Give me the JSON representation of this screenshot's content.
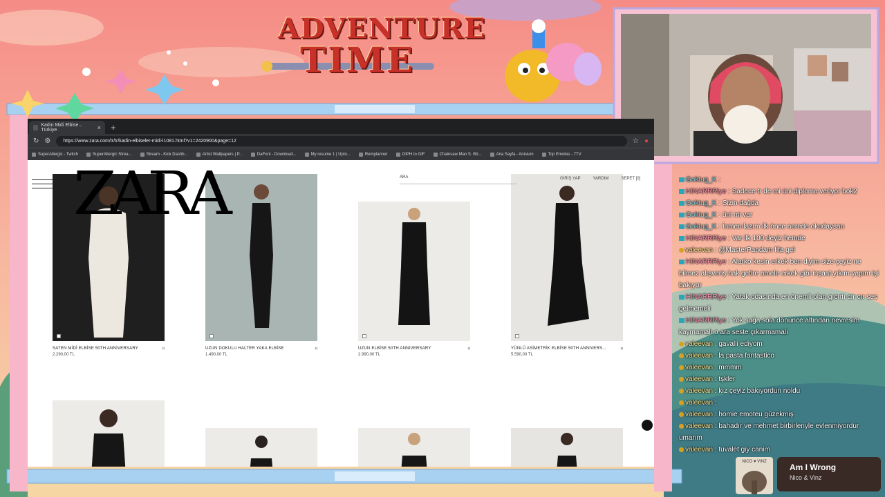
{
  "overlay": {
    "title_line1": "ADVENTURE",
    "title_line2": "TIME",
    "accent": "#c8302a",
    "frame_color": "#a8d0f0"
  },
  "browser": {
    "tab_title": "Kadın Midi Elbise... Türkiye",
    "new_tab": "+",
    "url": "https://www.zara.com/tr/tr/kadin-elbiseler-midi-l1081.html?v1=2420900&page=12",
    "bookmarks": [
      "SuperAllergic - Twitch",
      "SuperAllergic Strea...",
      "Stream - Kick Dashb...",
      "Artist Wallpapers | P...",
      "DaFont - Download...",
      "My resume 1 | Upto...",
      "Remplanner",
      "GIPH to GIF",
      "Chainsaw Man S. Bö...",
      "Ana Sayfa - Anisium",
      "Top Emotes - 7TV"
    ]
  },
  "zara": {
    "logo": "ZARA",
    "search_label": "ARA",
    "links": [
      "GİRİŞ YAP",
      "YARDIM",
      "SEPET [0]"
    ],
    "products": [
      {
        "name": "SATEN MİDİ ELBİSE 50TH ANNIVERSARY",
        "price": "2.290,00 TL",
        "color": "#ede8df"
      },
      {
        "name": "UZUN DOKULU HALTER YAKA ELBİSE",
        "price": "1.490,00 TL",
        "color": "#111111"
      },
      {
        "name": "UZUN ELBİSE 50TH ANNIVERSARY",
        "price": "2.990,00 TL",
        "color": "#111111"
      },
      {
        "name": "YÜNLÜ ASİMETRİK ELBİSE 50TH ANNIVERS...",
        "price": "5.590,00 TL",
        "color": "#111111"
      }
    ]
  },
  "chat": [
    {
      "user": "Goktug_K",
      "text": "",
      "color": "u1"
    },
    {
      "user": "HINARRRiye",
      "text": "Sadece tr de mi üni diploma veriyor bok2",
      "color": "u2"
    },
    {
      "user": "Goktug_K",
      "text": "Sizin dağda",
      "color": "u1"
    },
    {
      "user": "Goktug_K",
      "text": "üni mi var",
      "color": "u1"
    },
    {
      "user": "Goktug_K",
      "text": "İnmen lazım ilk önce nerede okudaysan",
      "color": "u1"
    },
    {
      "user": "HINARRRiye",
      "text": "Var ilk 100 deyiz hemde",
      "color": "u2"
    },
    {
      "user": "valeevan",
      "text": "@MasterPandam fifa gel",
      "color": "u3"
    },
    {
      "user": "HINARRRiye",
      "text": "Alarko kesin erkek ben diyim size çeyiz ne bilmez alışveriş hak getire amele erkek gibi inşaat yıkım yapım işi bakıyor",
      "color": "u2"
    },
    {
      "user": "HINARRRiye",
      "text": "Yatak odasında en önemli olan gıcırtı cır cır ses gelmemeli",
      "color": "u2"
    },
    {
      "user": "HINARRRiye",
      "text": "Yok sağa sola dönünce altından nevresim kaymamalı o ara seste çıkarmamalı",
      "color": "u2"
    },
    {
      "user": "valeevan",
      "text": "gavalli ediyom",
      "color": "u3"
    },
    {
      "user": "valeevan",
      "text": "la pasta fantastico",
      "color": "u3"
    },
    {
      "user": "valeevan",
      "text": "mmmm",
      "color": "u3"
    },
    {
      "user": "valeevan",
      "text": "tşkler",
      "color": "u3"
    },
    {
      "user": "valeevan",
      "text": "kız çeyiz bakıyordun noldu",
      "color": "u3"
    },
    {
      "user": "valeevan",
      "text": "",
      "color": "u3"
    },
    {
      "user": "valeevan",
      "text": "homie emoteu güzekmiş",
      "color": "u3"
    },
    {
      "user": "valeevan",
      "text": "bahadır ve mehmet birbirleriyle evlenmiyordur umarım",
      "color": "u3"
    },
    {
      "user": "valeevan",
      "text": "tuvalet giy canim",
      "color": "u3"
    }
  ],
  "now_playing": {
    "title": "Am I Wrong",
    "artist": "Nico & Vinz",
    "album_text": "NICO ♥ VINZ"
  }
}
